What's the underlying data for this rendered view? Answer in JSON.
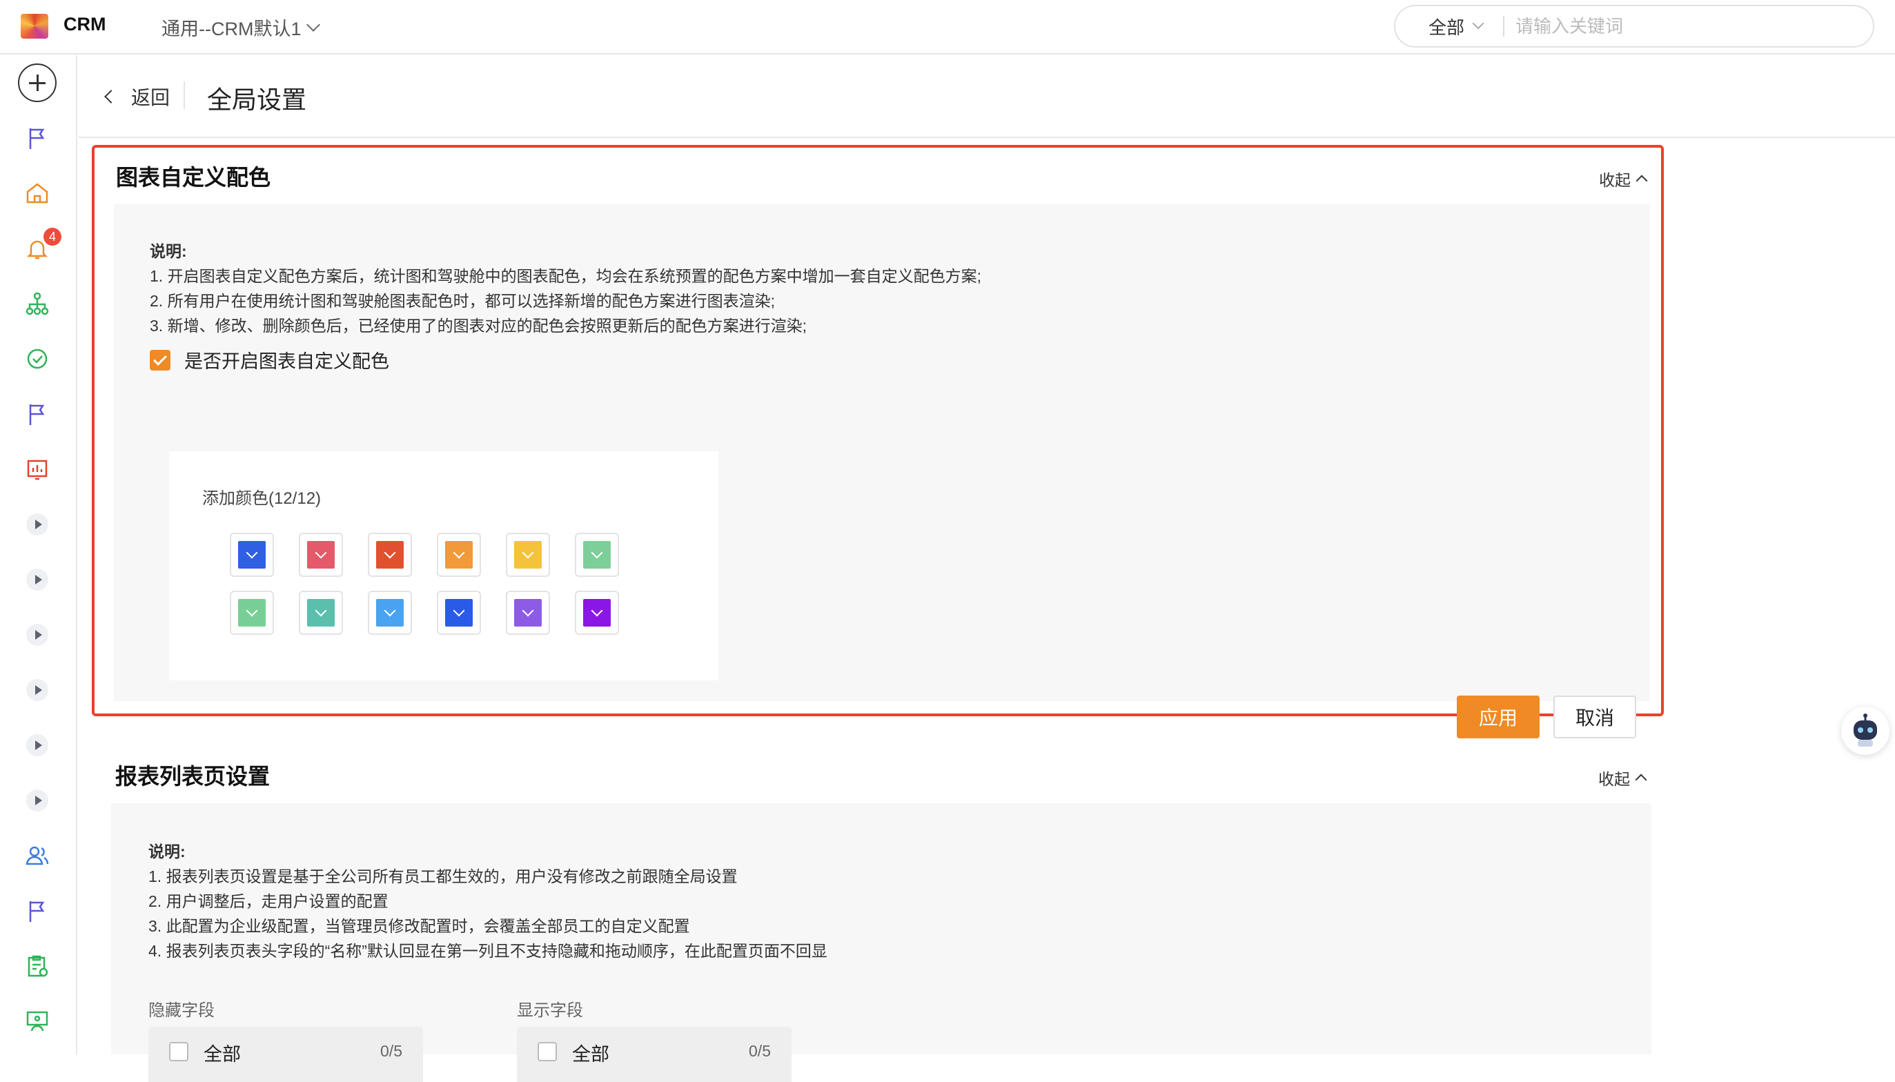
{
  "topbar": {
    "app_name": "CRM",
    "workspace": "通用--CRM默认1",
    "search_scope": "全部",
    "search_placeholder": "请输入关键词"
  },
  "sidebar": {
    "notification_count": "4",
    "icons": [
      "add-icon",
      "flag-icon",
      "home-icon",
      "bell-icon",
      "org-icon",
      "check-circle-icon",
      "flag-icon",
      "report-icon",
      "expand-icon",
      "expand-icon",
      "expand-icon",
      "expand-icon",
      "expand-icon",
      "expand-icon",
      "users-icon",
      "flag-icon",
      "clipboard-icon",
      "teacher-icon"
    ]
  },
  "header": {
    "back_label": "返回",
    "title": "全局设置"
  },
  "chart_color_section": {
    "title": "图表自定义配色",
    "collapse_label": "收起",
    "desc_heading": "说明:",
    "desc_lines": [
      "1. 开启图表自定义配色方案后，统计图和驾驶舱中的图表配色，均会在系统预置的配色方案中增加一套自定义配色方案;",
      "2. 所有用户在使用统计图和驾驶舱图表配色时，都可以选择新增的配色方案进行图表渲染;",
      "3. 新增、修改、删除颜色后，已经使用了的图表对应的配色会按照更新后的配色方案进行渲染;"
    ],
    "enable_label": "是否开启图表自定义配色",
    "enabled": true,
    "add_color_label": "添加颜色(12/12)",
    "colors": [
      "#2f5fe3",
      "#e45a6a",
      "#e2512f",
      "#f09a3a",
      "#f5c33b",
      "#7ccf99",
      "#78cf95",
      "#5bbfae",
      "#4aa3f0",
      "#2a5ae8",
      "#8d5ce6",
      "#8b17e6"
    ],
    "apply_label": "应用",
    "cancel_label": "取消"
  },
  "report_list_section": {
    "title": "报表列表页设置",
    "collapse_label": "收起",
    "desc_heading": "说明:",
    "desc_lines": [
      "1. 报表列表页设置是基于全公司所有员工都生效的，用户没有修改之前跟随全局设置",
      "2. 用户调整后，走用户设置的配置",
      "3. 此配置为企业级配置，当管理员修改配置时，会覆盖全部员工的自定义配置",
      "4. 报表列表页表头字段的“名称”默认回显在第一列且不支持隐藏和拖动顺序，在此配置页面不回显"
    ],
    "hidden_fields": {
      "label": "隐藏字段",
      "all_label": "全部",
      "count": "0/5"
    },
    "shown_fields": {
      "label": "显示字段",
      "all_label": "全部",
      "count": "0/5"
    }
  },
  "assistant": {
    "icon": "robot-icon"
  }
}
